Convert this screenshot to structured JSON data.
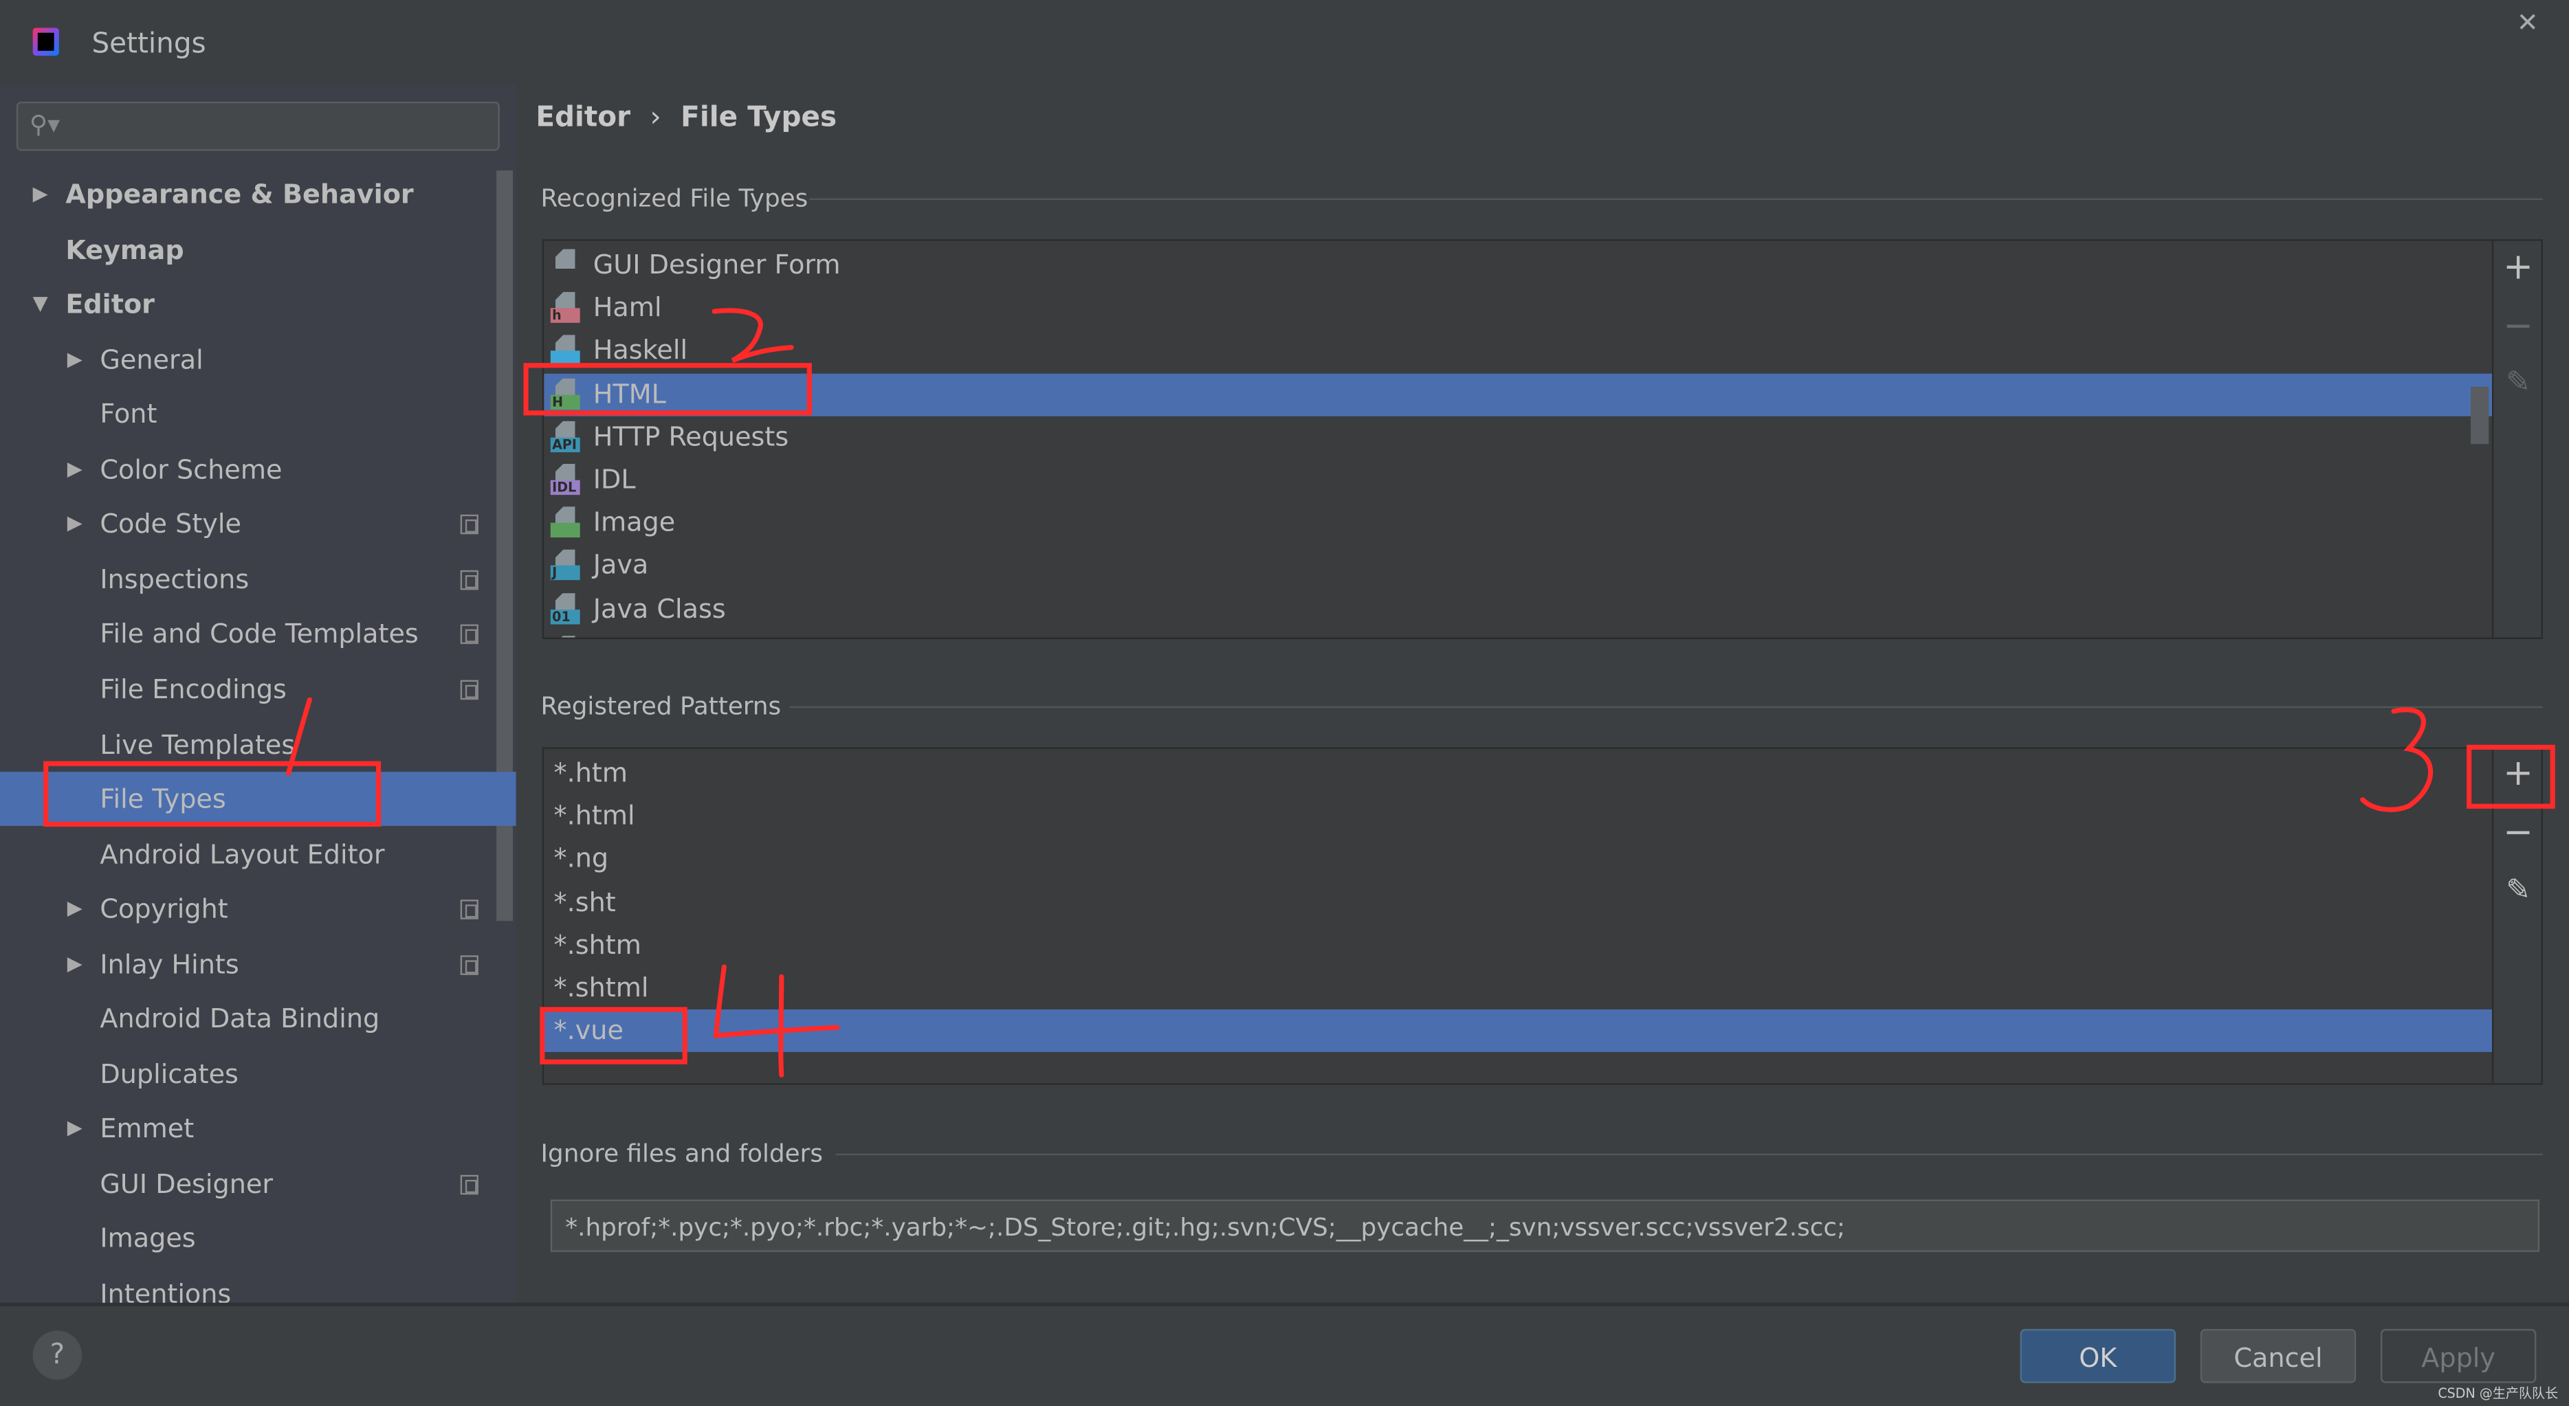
{
  "window": {
    "title": "Settings",
    "close_icon": "close-icon",
    "app_icon": "intellij-idea-icon"
  },
  "search": {
    "placeholder": "",
    "value": ""
  },
  "sidebar": {
    "items": [
      {
        "label": "Appearance & Behavior",
        "level": 0,
        "arrow": "right",
        "copy": false
      },
      {
        "label": "Keymap",
        "level": 0,
        "arrow": "",
        "copy": false
      },
      {
        "label": "Editor",
        "level": 0,
        "arrow": "down",
        "copy": false
      },
      {
        "label": "General",
        "level": 1,
        "arrow": "right",
        "copy": false
      },
      {
        "label": "Font",
        "level": 1,
        "arrow": "",
        "copy": false
      },
      {
        "label": "Color Scheme",
        "level": 1,
        "arrow": "right",
        "copy": false
      },
      {
        "label": "Code Style",
        "level": 1,
        "arrow": "right",
        "copy": true
      },
      {
        "label": "Inspections",
        "level": 1,
        "arrow": "",
        "copy": true
      },
      {
        "label": "File and Code Templates",
        "level": 1,
        "arrow": "",
        "copy": true
      },
      {
        "label": "File Encodings",
        "level": 1,
        "arrow": "",
        "copy": true
      },
      {
        "label": "Live Templates",
        "level": 1,
        "arrow": "",
        "copy": false
      },
      {
        "label": "File Types",
        "level": 1,
        "arrow": "",
        "copy": false,
        "selected": true
      },
      {
        "label": "Android Layout Editor",
        "level": 1,
        "arrow": "",
        "copy": false
      },
      {
        "label": "Copyright",
        "level": 1,
        "arrow": "right",
        "copy": true
      },
      {
        "label": "Inlay Hints",
        "level": 1,
        "arrow": "right",
        "copy": true
      },
      {
        "label": "Android Data Binding",
        "level": 1,
        "arrow": "",
        "copy": false
      },
      {
        "label": "Duplicates",
        "level": 1,
        "arrow": "",
        "copy": false
      },
      {
        "label": "Emmet",
        "level": 1,
        "arrow": "right",
        "copy": false
      },
      {
        "label": "GUI Designer",
        "level": 1,
        "arrow": "",
        "copy": true
      },
      {
        "label": "Images",
        "level": 1,
        "arrow": "",
        "copy": false
      },
      {
        "label": "Intentions",
        "level": 1,
        "arrow": "",
        "copy": false
      }
    ]
  },
  "breadcrumb": {
    "parent": "Editor",
    "separator": "›",
    "current": "File Types"
  },
  "recognized": {
    "label": "Recognized File Types",
    "items": [
      {
        "label": "GUI Designer Form",
        "tag": "",
        "color": ""
      },
      {
        "label": "Haml",
        "tag": "h",
        "color": "#c2707c"
      },
      {
        "label": "Haskell",
        "tag": "",
        "color": "#3fa7d6"
      },
      {
        "label": "HTML",
        "tag": "H",
        "color": "#5c9f5c",
        "selected": true
      },
      {
        "label": "HTTP Requests",
        "tag": "API",
        "color": "#3b94b3"
      },
      {
        "label": "IDL",
        "tag": "IDL",
        "color": "#9a7fc7"
      },
      {
        "label": "Image",
        "tag": "",
        "color": "#5c9f5c"
      },
      {
        "label": "Java",
        "tag": "J",
        "color": "#3b94b3"
      },
      {
        "label": "Java Class",
        "tag": "01",
        "color": "#3b94b3"
      }
    ]
  },
  "patterns": {
    "label": "Registered Patterns",
    "items": [
      {
        "label": "*.htm"
      },
      {
        "label": "*.html"
      },
      {
        "label": "*.ng"
      },
      {
        "label": "*.sht"
      },
      {
        "label": "*.shtm"
      },
      {
        "label": "*.shtml"
      },
      {
        "label": "*.vue",
        "selected": true
      }
    ]
  },
  "toolbar": {
    "add": "+",
    "remove": "−",
    "edit": "✎"
  },
  "ignore": {
    "label": "Ignore files and folders",
    "value": "*.hprof;*.pyc;*.pyo;*.rbc;*.yarb;*~;.DS_Store;.git;.hg;.svn;CVS;__pycache__;_svn;vssver.scc;vssver2.scc;"
  },
  "footer": {
    "help": "?",
    "ok": "OK",
    "cancel": "Cancel",
    "apply": "Apply"
  },
  "watermark": "CSDN @生产队队长",
  "colors": {
    "selection": "#4b6eaf",
    "annotation": "#ff2a2a",
    "ok_button": "#365880"
  }
}
